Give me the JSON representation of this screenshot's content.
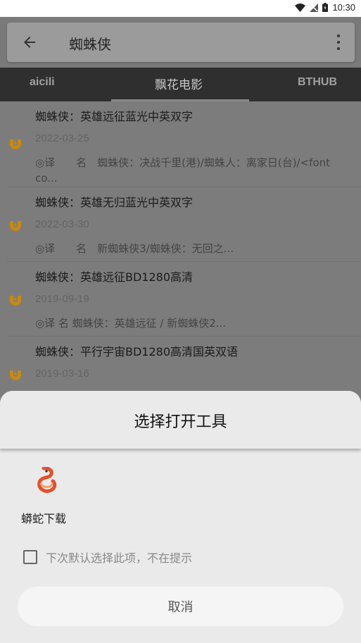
{
  "status_bar": {
    "time": "10:30"
  },
  "header": {
    "search_query": "蜘蛛侠",
    "tabs": [
      {
        "label": "aicili"
      },
      {
        "label": "飘花电影"
      },
      {
        "label": "BTHUB"
      }
    ],
    "active_tab": 1
  },
  "results": [
    {
      "title": "蜘蛛侠：英雄远征蓝光中英双字",
      "date": "2022-03-25",
      "desc_line1": "◎译　　名　蜘蛛侠：决战千里(港)/蜘蛛人：离家日(台)/<font",
      "desc_line2": "co..."
    },
    {
      "title": "蜘蛛侠：英雄无归蓝光中英双字",
      "date": "2022-03-30",
      "desc_line1": "◎译　　名　新蜘蛛侠3/蜘蛛侠：无回之...",
      "desc_line2": ""
    },
    {
      "title": "蜘蛛侠：英雄远征BD1280高清",
      "date": "2019-09-19",
      "desc_line1": "◎译 名 蜘蛛侠：英雄远征 / 新蜘蛛侠2...",
      "desc_line2": ""
    },
    {
      "title": "蜘蛛侠：平行宇宙BD1280高清国英双语",
      "date": "2019-03-16",
      "desc_line1": "",
      "desc_line2": ""
    }
  ],
  "dialog": {
    "title": "选择打开工具",
    "apps": [
      {
        "label": "蟒蛇下载",
        "icon": "python-snake-icon"
      }
    ],
    "remember_choice_label": "下次默认选择此项，不在提示",
    "remember_checked": false,
    "cancel_label": "取消"
  },
  "colors": {
    "magnet_icon": "#c98a10",
    "snake_icon": "#e2502a",
    "dim_overlay": "#7c7c7c",
    "tab_bar": "#2f2f2f",
    "sheet_bg": "#eaeaea"
  }
}
